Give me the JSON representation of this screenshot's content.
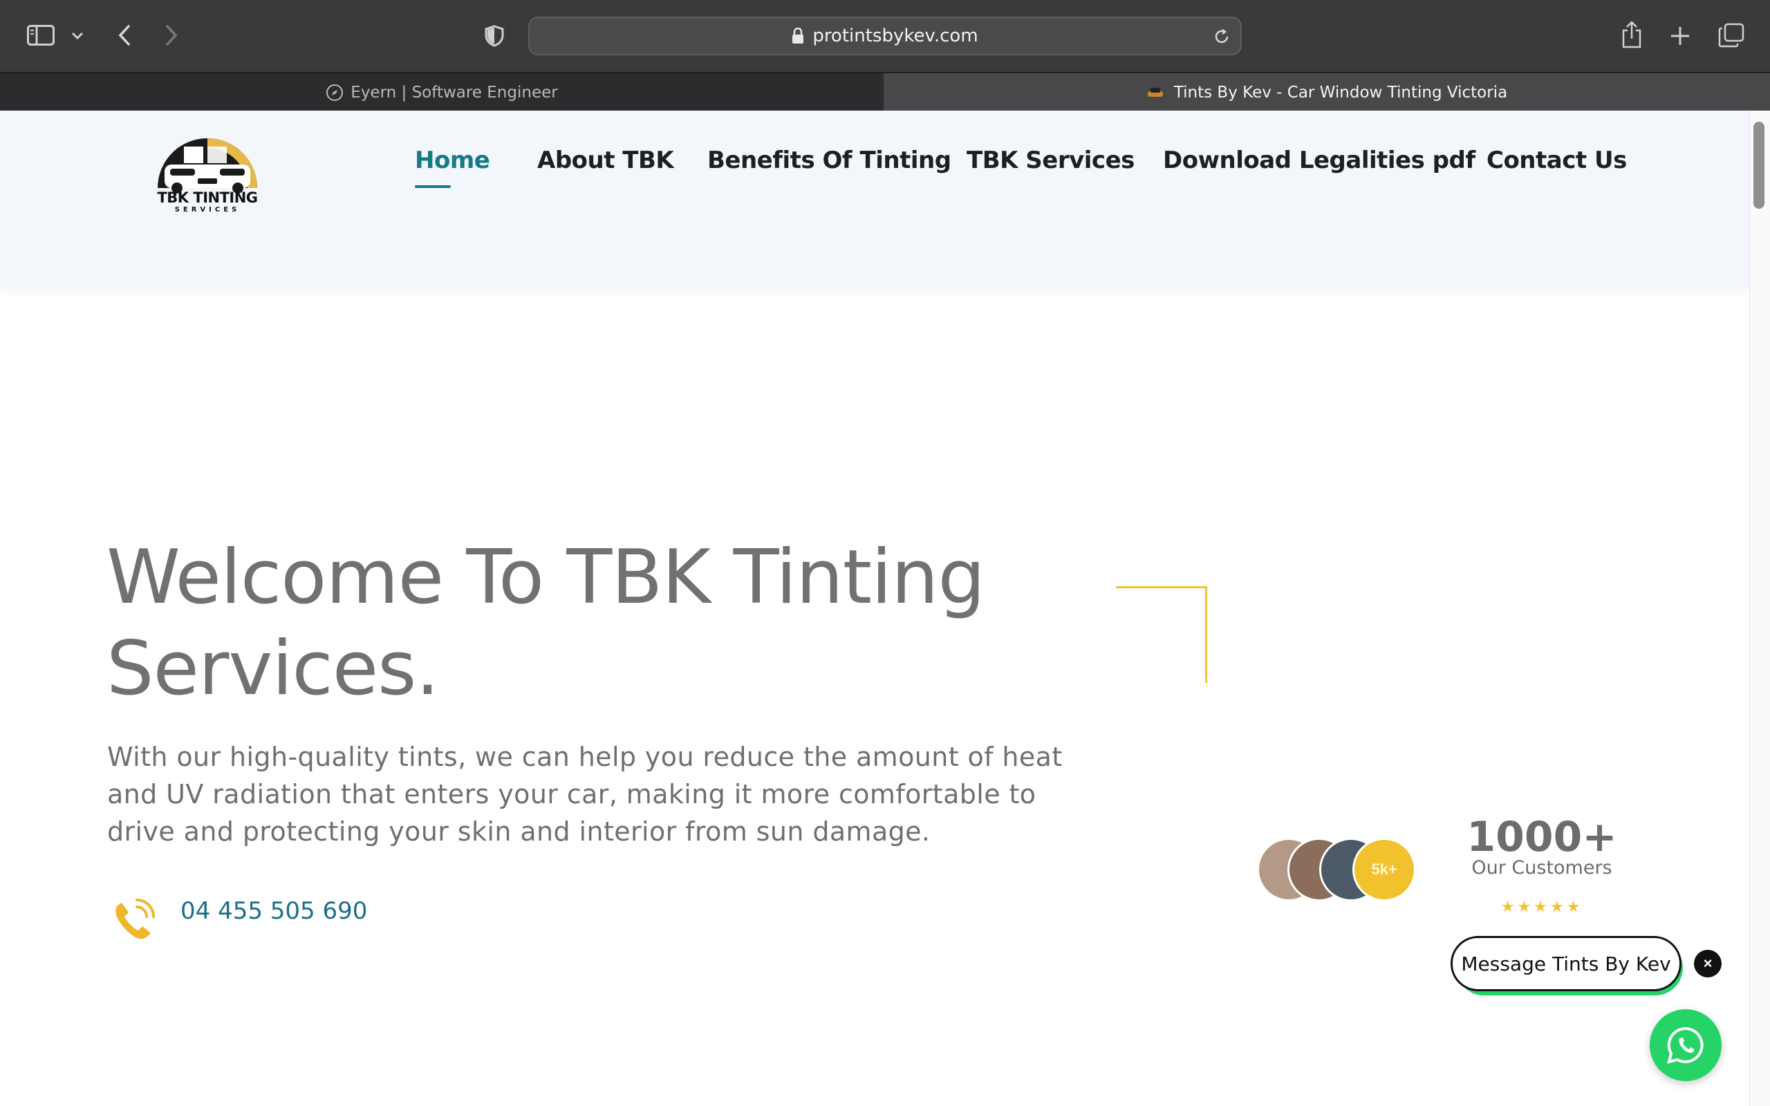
{
  "browser": {
    "url": "protintsbykev.com",
    "tabs": [
      {
        "title": "Eyern | Software Engineer",
        "active": false
      },
      {
        "title": "Tints By Kev - Car Window Tinting Victoria",
        "active": true
      }
    ]
  },
  "site": {
    "logo_text": "TBK TINTING",
    "logo_subtext": "SERVICES",
    "nav": [
      "Home",
      "About TBK",
      "Benefits Of Tinting",
      "TBK Services",
      "Download Legalities pdf",
      "Contact Us"
    ],
    "active_nav": "Home",
    "accent_color": "#147a86",
    "highlight_color": "#f2c12e"
  },
  "hero": {
    "title_line1": "Welcome To TBK Tinting",
    "title_line2": "Services.",
    "description_line1": "With our high-quality tints, we can help you reduce the amount of heat",
    "description_line2": "and UV radiation that enters your car, making it more comfortable to",
    "description_line3": "drive and protecting your skin and interior from sun damage.",
    "phone": "04 455 505 690",
    "phone_icon": "phone-icon"
  },
  "customers": {
    "badge": "5k+",
    "count": "1000+",
    "label": "Our Customers",
    "rating": 5,
    "stars": "★★★★★"
  },
  "chat": {
    "message_label": "Message Tints By Kev",
    "close_label": "×",
    "whatsapp_color": "#25d366"
  }
}
